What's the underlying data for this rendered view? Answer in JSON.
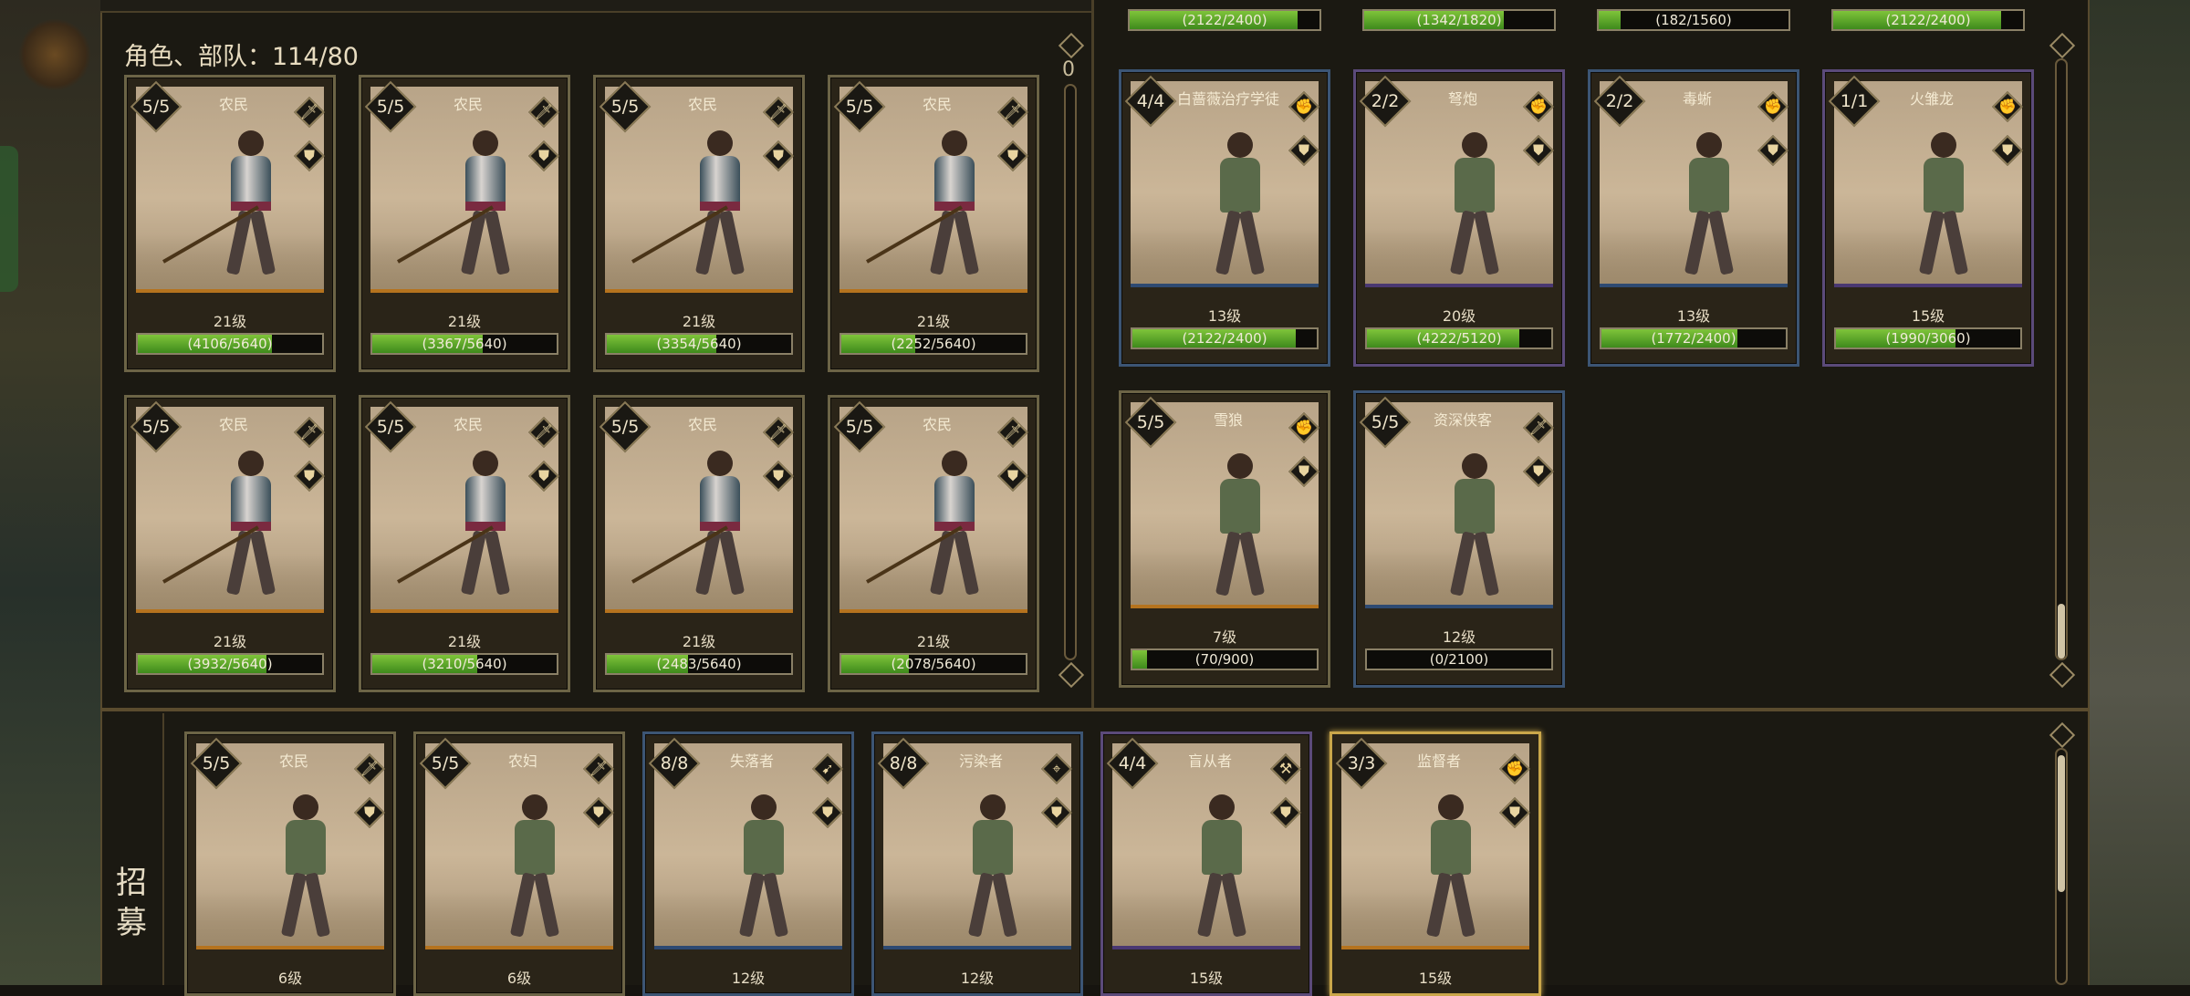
{
  "roster": {
    "title": "角色、部队：114/80",
    "scroll_index": "0",
    "cards": [
      {
        "stack": "5/5",
        "name": "农民",
        "level": "21级",
        "hp": "(4106/5640)",
        "fill": 0.728,
        "role": "spear",
        "icon1": "sword-icon",
        "icon2": "shield-icon",
        "frame": "brown"
      },
      {
        "stack": "5/5",
        "name": "农民",
        "level": "21级",
        "hp": "(3367/5640)",
        "fill": 0.597,
        "role": "spear",
        "icon1": "sword-icon",
        "icon2": "shield-icon",
        "frame": "brown"
      },
      {
        "stack": "5/5",
        "name": "农民",
        "level": "21级",
        "hp": "(3354/5640)",
        "fill": 0.595,
        "role": "spear",
        "icon1": "sword-icon",
        "icon2": "shield-icon",
        "frame": "brown"
      },
      {
        "stack": "5/5",
        "name": "农民",
        "level": "21级",
        "hp": "(2252/5640)",
        "fill": 0.399,
        "role": "spear",
        "icon1": "sword-icon",
        "icon2": "shield-icon",
        "frame": "brown"
      },
      {
        "stack": "5/5",
        "name": "农民",
        "level": "21级",
        "hp": "(3932/5640)",
        "fill": 0.697,
        "role": "spear",
        "icon1": "sword-icon",
        "icon2": "shield-icon",
        "frame": "brown"
      },
      {
        "stack": "5/5",
        "name": "农民",
        "level": "21级",
        "hp": "(3210/5640)",
        "fill": 0.569,
        "role": "spear",
        "icon1": "sword-icon",
        "icon2": "shield-icon",
        "frame": "brown"
      },
      {
        "stack": "5/5",
        "name": "农民",
        "level": "21级",
        "hp": "(2483/5640)",
        "fill": 0.44,
        "role": "spear",
        "icon1": "sword-icon",
        "icon2": "shield-icon",
        "frame": "brown"
      },
      {
        "stack": "5/5",
        "name": "农民",
        "level": "21级",
        "hp": "(2078/5640)",
        "fill": 0.368,
        "role": "spear",
        "icon1": "sword-icon",
        "icon2": "shield-icon",
        "frame": "brown"
      }
    ]
  },
  "right_panel": {
    "top_bars": [
      {
        "hp": "(2122/2400)",
        "fill": 0.884
      },
      {
        "hp": "(1342/1820)",
        "fill": 0.737
      },
      {
        "hp": "(182/1560)",
        "fill": 0.117
      },
      {
        "hp": "(2122/2400)",
        "fill": 0.884
      }
    ],
    "cards": [
      {
        "stack": "4/4",
        "name": "白蔷薇治疗学徒",
        "level": "13级",
        "hp": "(2122/2400)",
        "fill": 0.884,
        "icon1": "fist-icon",
        "icon2": "shield-icon",
        "frame": "blue"
      },
      {
        "stack": "2/2",
        "name": "弩炮",
        "level": "20级",
        "hp": "(4222/5120)",
        "fill": 0.825,
        "icon1": "fist-icon",
        "icon2": "shield-icon",
        "frame": "purple"
      },
      {
        "stack": "2/2",
        "name": "毒蜥",
        "level": "13级",
        "hp": "(1772/2400)",
        "fill": 0.738,
        "icon1": "fist-icon",
        "icon2": "shield-icon",
        "frame": "blue"
      },
      {
        "stack": "1/1",
        "name": "火雏龙",
        "level": "15级",
        "hp": "(1990/3060)",
        "fill": 0.65,
        "icon1": "fist-icon",
        "icon2": "shield-icon",
        "frame": "purple"
      },
      {
        "stack": "5/5",
        "name": "雪狼",
        "level": "7级",
        "hp": "(70/900)",
        "fill": 0.078,
        "icon1": "fist-icon",
        "icon2": "shield-icon",
        "frame": "brown"
      },
      {
        "stack": "5/5",
        "name": "资深侠客",
        "level": "12级",
        "hp": "(0/2100)",
        "fill": 0.0,
        "icon1": "sword-icon",
        "icon2": "shield-icon",
        "frame": "blue"
      }
    ]
  },
  "recruit": {
    "label": "招募",
    "cards": [
      {
        "stack": "5/5",
        "name": "农民",
        "level": "6级",
        "icon1": "sword-icon",
        "icon2": "shield-icon",
        "frame": "brown"
      },
      {
        "stack": "5/5",
        "name": "农妇",
        "level": "6级",
        "icon1": "sword-icon",
        "icon2": "shield-icon",
        "frame": "brown"
      },
      {
        "stack": "8/8",
        "name": "失落者",
        "level": "12级",
        "icon1": "bow-icon",
        "icon2": "shield-icon",
        "frame": "blue"
      },
      {
        "stack": "8/8",
        "name": "污染者",
        "level": "12级",
        "icon1": "crossbow-icon",
        "icon2": "shield-icon",
        "frame": "blue"
      },
      {
        "stack": "4/4",
        "name": "盲从者",
        "level": "15级",
        "icon1": "axe-icon",
        "icon2": "shield-icon",
        "frame": "purple"
      },
      {
        "stack": "3/3",
        "name": "监督者",
        "level": "15级",
        "icon1": "fist-icon",
        "icon2": "shield-icon",
        "frame": "gold"
      }
    ]
  },
  "icons": {
    "sword-icon": "🗡",
    "shield-icon": "⛊",
    "fist-icon": "✊",
    "bow-icon": "➹",
    "crossbow-icon": "⌖",
    "axe-icon": "⚒"
  },
  "colors": {
    "hp_green": "#5fae2c",
    "frame_gold": "#c9a64a",
    "frame_blue": "#3c5574",
    "frame_purple": "#5b4a7a"
  }
}
